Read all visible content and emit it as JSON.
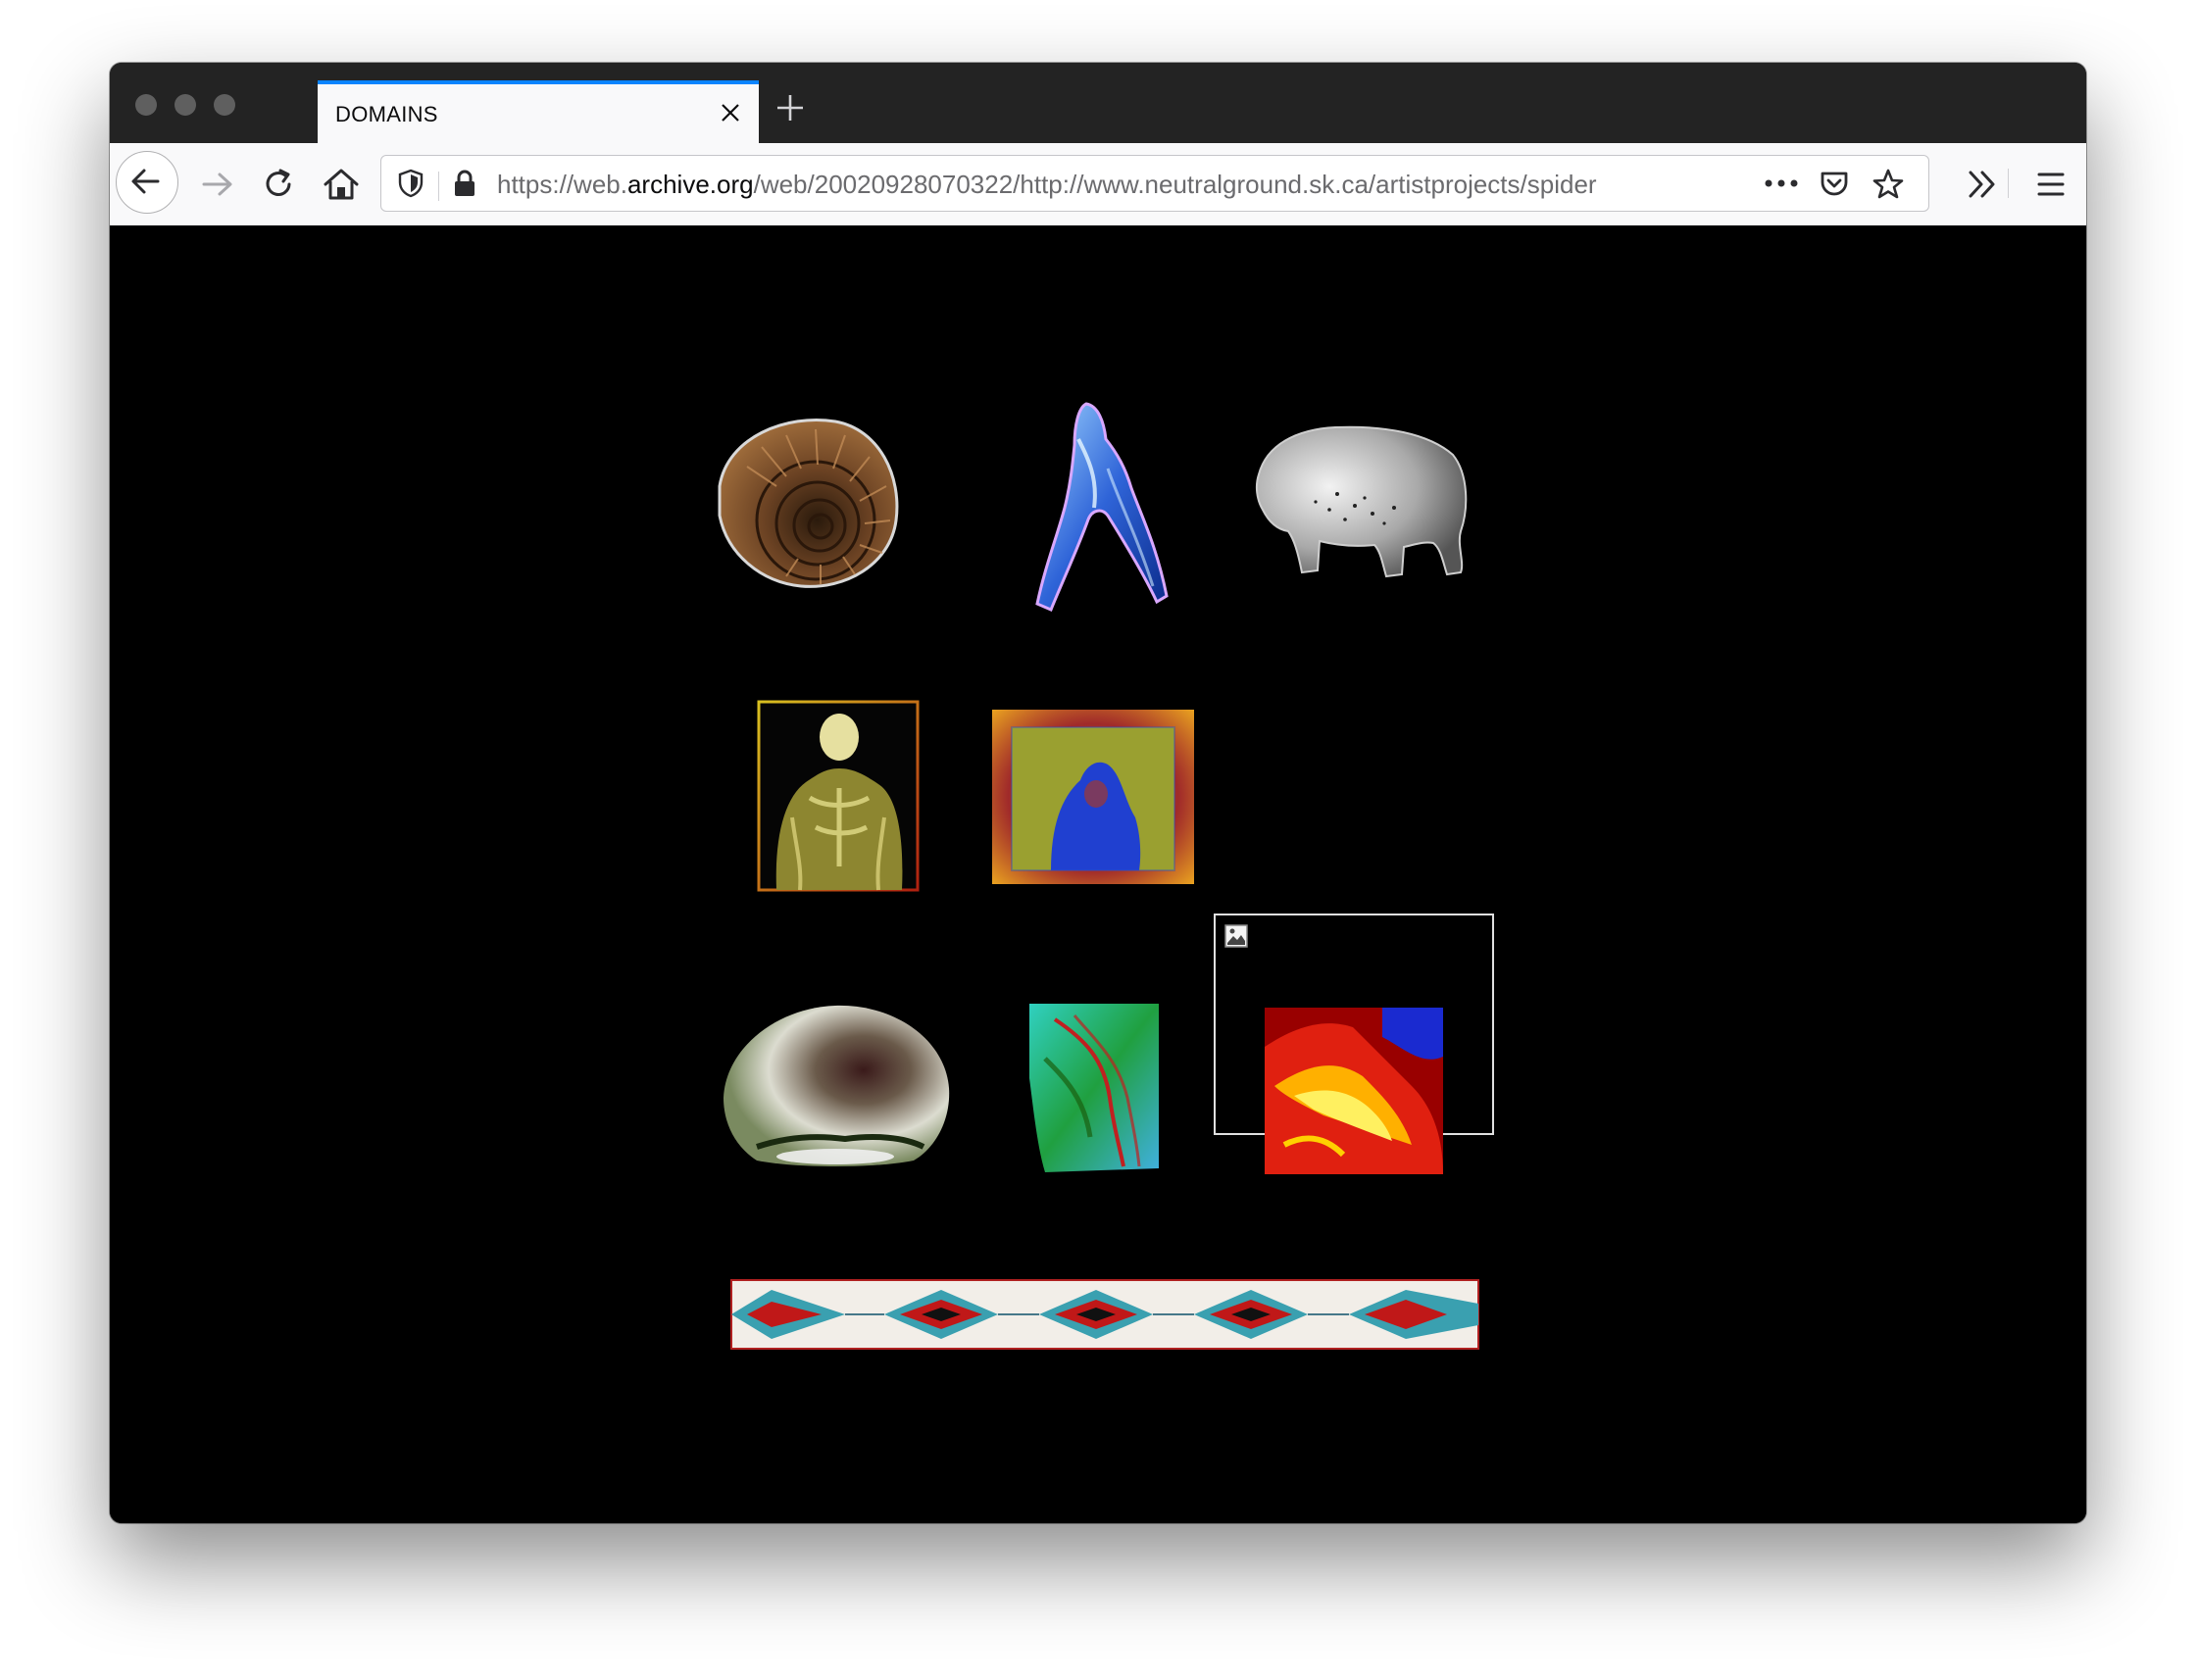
{
  "browser": {
    "tab": {
      "title": "DOMAINS"
    },
    "url": {
      "prefix": "https://web.",
      "host": "archive.org",
      "path": "/web/20020928070322/http://www.neutralground.sk.ca/artistprojects/spider"
    },
    "icons": {
      "back": "arrow-left-icon",
      "forward": "arrow-right-icon",
      "reload": "reload-icon",
      "home": "home-icon",
      "shield": "shield-icon",
      "lock": "lock-icon",
      "more": "ellipsis-icon",
      "pocket": "pocket-icon",
      "bookmark": "star-icon",
      "overflow": "double-chevron-icon",
      "menu": "hamburger-icon"
    },
    "colors": {
      "tab_accent": "#0a84ff",
      "chrome_dark": "#232323",
      "toolbar": "#f9f9fa"
    }
  },
  "page": {
    "background": "#000000",
    "images": [
      "ammonite-fossil",
      "blue-bone-figure",
      "bison",
      "golden-torso",
      "hooded-figure",
      "broken-image",
      "eye-dome",
      "green-stone",
      "fire",
      "beadwork-band"
    ]
  }
}
